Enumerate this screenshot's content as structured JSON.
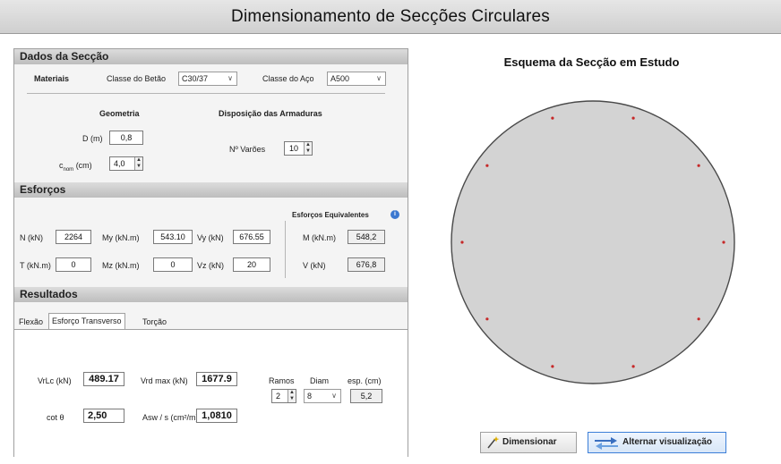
{
  "window": {
    "title": "Dimensionamento de Secções Circulares"
  },
  "sections": {
    "dados": "Dados da Secção",
    "esforcos": "Esforços",
    "resultados": "Resultados"
  },
  "materiais": {
    "label": "Materiais",
    "betao_label": "Classe do Betão",
    "betao_value": "C30/37",
    "aco_label": "Classe do Aço",
    "aco_value": "A500"
  },
  "geometria": {
    "title": "Geometria",
    "d_label": "D (m)",
    "d_value": "0,8",
    "c_label_pre": "c",
    "c_label_sub": "nom",
    "c_label_post": "(cm)",
    "c_value": "4,0"
  },
  "armaduras": {
    "title": "Disposição das Armaduras",
    "n_label": "Nº Varões",
    "n_value": "10"
  },
  "esforcos": {
    "equiv_title": "Esforços Equivalentes",
    "n_label": "N (kN)",
    "n_value": "2264",
    "my_label": "My (kN.m)",
    "my_value": "543.10",
    "vy_label": "Vy (kN)",
    "vy_value": "676.55",
    "m_label": "M (kN.m)",
    "m_value": "548,2",
    "t_label": "T (kN.m)",
    "t_value": "0",
    "mz_label": "Mz (kN.m)",
    "mz_value": "0",
    "vz_label": "Vz (kN)",
    "vz_value": "20",
    "v_label": "V (kN)",
    "v_value": "676,8"
  },
  "tabs": [
    "Flexão",
    "Esforço Transverso",
    "Torção"
  ],
  "active_tab": 1,
  "resultados": {
    "vrdc_label": "VrLc (kN)",
    "vrdc_value": "489.17",
    "vrdmax_label": "Vrd max (kN)",
    "vrdmax_value": "1677.9",
    "cot_label": "cot θ",
    "cot_value": "2,50",
    "asw_label": "Asw / s (cm²/m)",
    "asw_value": "1,0810",
    "ramos_label": "Ramos",
    "ramos_value": "2",
    "diam_label": "Diam",
    "diam_value": "8",
    "esp_label": "esp. (cm)",
    "esp_value": "5,2"
  },
  "scheme": {
    "title": "Esquema da Secção em Estudo",
    "bar_count": 10,
    "circle_fill": "#d3d3d3",
    "bar_color": "#c62828"
  },
  "buttons": {
    "dimensionar": "Dimensionar",
    "alternar": "Alternar visualização"
  }
}
